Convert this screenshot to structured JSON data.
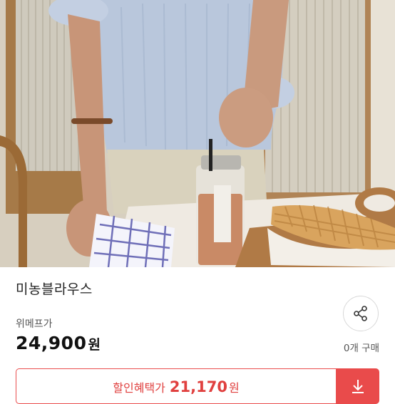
{
  "product": {
    "title": "미농블라우스",
    "price_label": "위메프가",
    "price": "24,900",
    "price_unit": "원",
    "purchase_count": "0개 구매"
  },
  "discount": {
    "label": "할인혜택가",
    "price": "21,170",
    "unit": "원"
  },
  "icons": {
    "share": "share-icon",
    "download": "download-arrow-icon"
  },
  "colors": {
    "accent": "#e94b4b",
    "accent_text": "#e0403f"
  }
}
